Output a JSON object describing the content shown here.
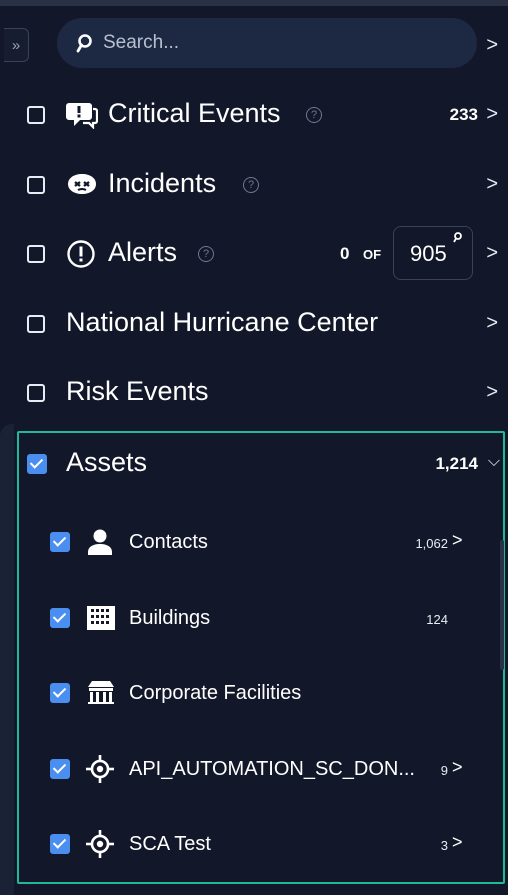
{
  "toolbar": {
    "expand_glyph": "»"
  },
  "search": {
    "placeholder": "Search...",
    "chevron": ">"
  },
  "layers": [
    {
      "label": "Critical Events",
      "count": "233",
      "icon": "chat-alert-icon"
    },
    {
      "label": "Incidents",
      "count": "",
      "icon": "incident-icon"
    },
    {
      "label": "Alerts",
      "count_prefix": "0",
      "of": "OF",
      "total": "905",
      "icon": "alert-circle-icon"
    },
    {
      "label": "National Hurricane Center"
    },
    {
      "label": "Risk Events"
    }
  ],
  "assets": {
    "label": "Assets",
    "count": "1,214",
    "items": [
      {
        "label": "Contacts",
        "count": "1,062",
        "icon": "person-icon"
      },
      {
        "label": "Buildings",
        "count": "124",
        "icon": "building-grid-icon"
      },
      {
        "label": "Corporate Facilities",
        "count": "",
        "icon": "facility-icon"
      },
      {
        "label": "API_AUTOMATION_SC_DON...",
        "count": "9",
        "icon": "target-icon"
      },
      {
        "label": "SCA Test",
        "count": "3",
        "icon": "target-icon"
      }
    ]
  },
  "colors": {
    "background": "#121829",
    "accent": "#4a8ef0",
    "highlight_border": "#1fb89a"
  },
  "glyphs": {
    "chevron_right": ">",
    "chevron_down": "⌵",
    "help": "?"
  }
}
